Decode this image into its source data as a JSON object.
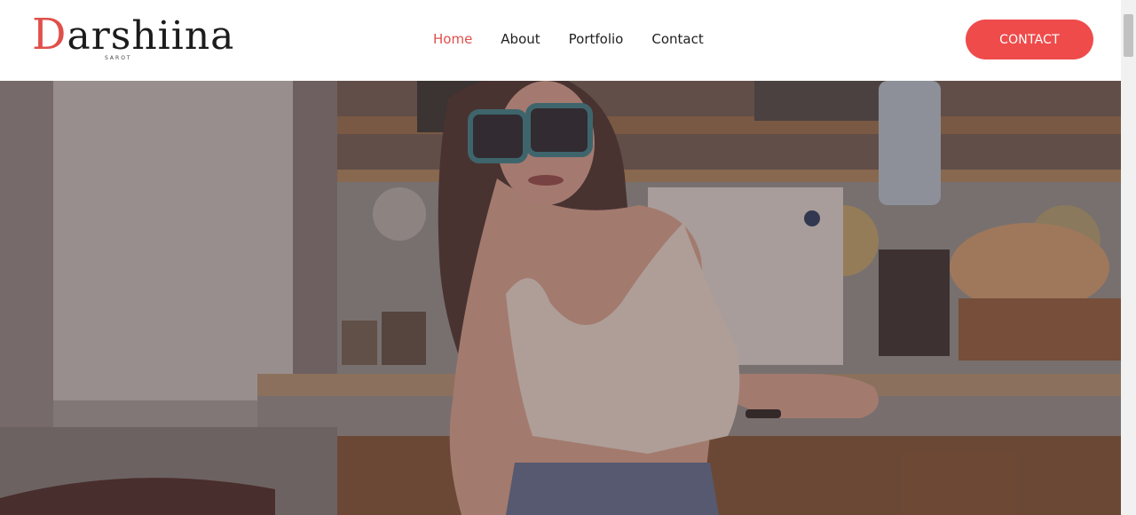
{
  "brand": {
    "name_initial": "D",
    "name_rest": "arshiina",
    "subtitle": "SAROT"
  },
  "nav": {
    "items": [
      {
        "label": "Home",
        "active": true
      },
      {
        "label": "About",
        "active": false
      },
      {
        "label": "Portfolio",
        "active": false
      },
      {
        "label": "Contact",
        "active": false
      }
    ]
  },
  "cta": {
    "label": "CONTACT"
  },
  "hero": {
    "image_alt": "woman-in-sunglasses-cafe-photo"
  },
  "colors": {
    "accent": "#e0504b",
    "button": "#ef4b4b",
    "text": "#1f1f1f"
  }
}
